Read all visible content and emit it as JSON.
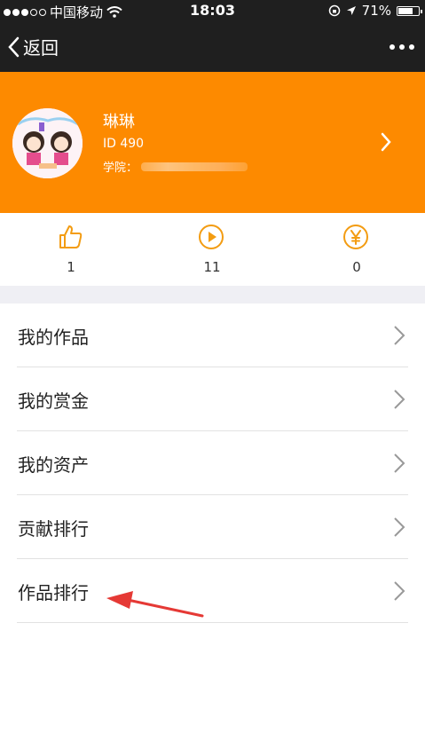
{
  "status_bar": {
    "carrier": "中国移动",
    "time": "18:03",
    "battery": "71%",
    "battery_level": 0.71
  },
  "nav": {
    "back_label": "返回",
    "more_icon": "more-dots-icon"
  },
  "profile": {
    "name": "琳琳",
    "id": "ID 490",
    "college_label": "学院："
  },
  "stats": [
    {
      "icon": "thumbs-up-icon",
      "value": "1"
    },
    {
      "icon": "play-icon",
      "value": "11"
    },
    {
      "icon": "yen-icon",
      "value": "0"
    }
  ],
  "menu": {
    "items": [
      {
        "label": "我的作品"
      },
      {
        "label": "我的赏金"
      },
      {
        "label": "我的资产"
      },
      {
        "label": "贡献排行"
      },
      {
        "label": "作品排行"
      }
    ]
  },
  "colors": {
    "accent": "#fd8a00",
    "nav_bg": "#1f1f1f",
    "annotation": "#e53935"
  }
}
